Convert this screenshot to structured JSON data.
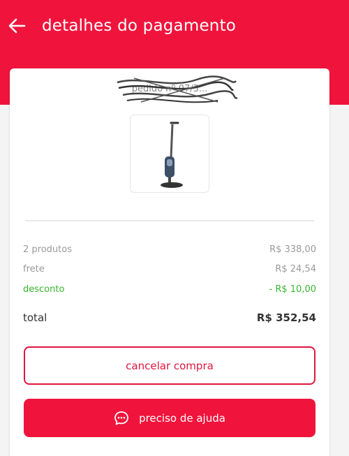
{
  "header": {
    "title": "detalhes do pagamento"
  },
  "order": {
    "id_label": "pedido nº 07/3..."
  },
  "summary": {
    "products_label": "2 produtos",
    "products_value": "R$ 338,00",
    "shipping_label": "frete",
    "shipping_value": "R$ 24,54",
    "discount_label": "desconto",
    "discount_value": "- R$ 10,00",
    "total_label": "total",
    "total_value": "R$ 352,54"
  },
  "actions": {
    "cancel_label": "cancelar compra",
    "help_label": "preciso de ajuda"
  },
  "colors": {
    "brand": "#f0143c",
    "discount": "#36b72e"
  }
}
